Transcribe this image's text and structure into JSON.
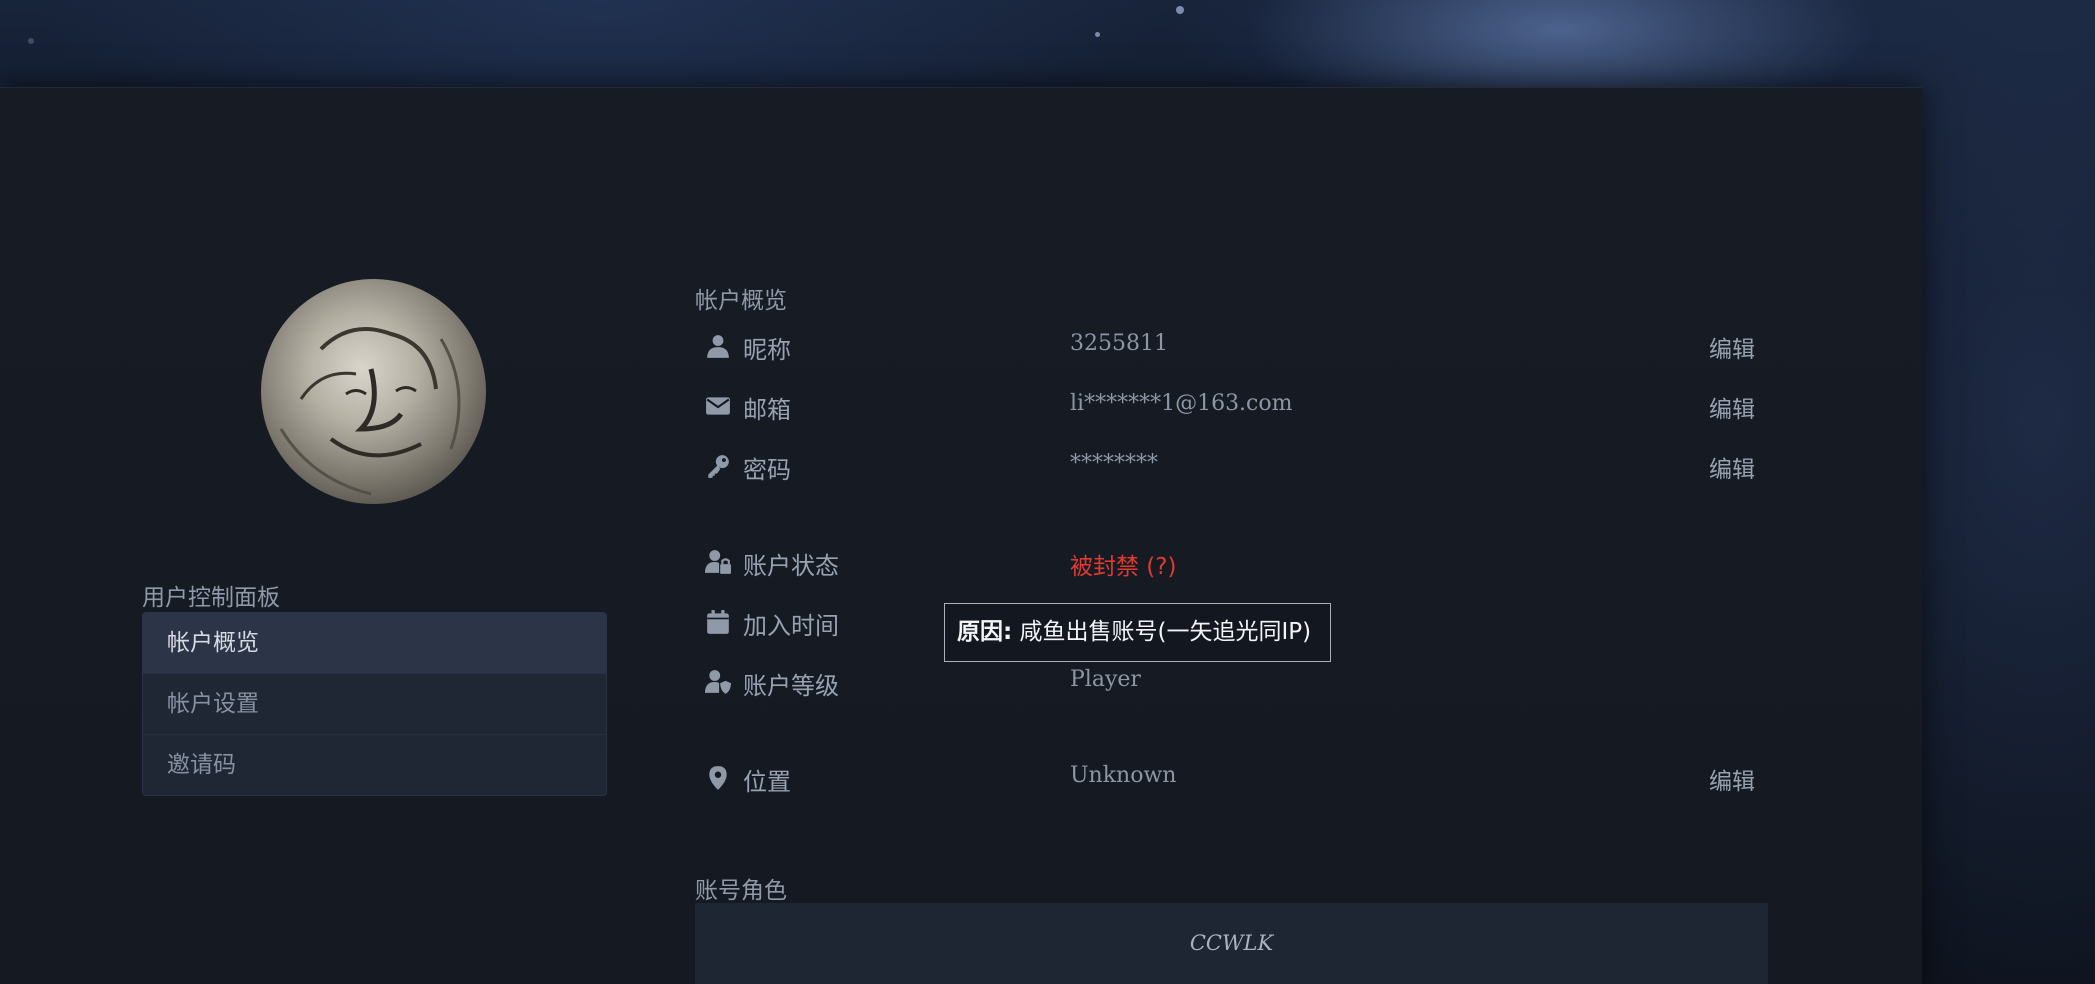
{
  "sidebar": {
    "title": "用户控制面板",
    "items": [
      {
        "label": "帐户概览",
        "active": true
      },
      {
        "label": "帐户设置",
        "active": false
      },
      {
        "label": "邀请码",
        "active": false
      }
    ]
  },
  "overview": {
    "title": "帐户概览",
    "rows": {
      "nickname": {
        "icon": "user-icon",
        "label": "昵称",
        "value": "3255811",
        "edit": "编辑"
      },
      "email": {
        "icon": "envelope-icon",
        "label": "邮箱",
        "value": "li*******1@163.com",
        "edit": "编辑"
      },
      "password": {
        "icon": "key-icon",
        "label": "密码",
        "value": "********",
        "edit": "编辑"
      },
      "status": {
        "icon": "user-lock-icon",
        "label": "账户状态",
        "value": "被封禁 (?)",
        "color": "#e0392f"
      },
      "joined": {
        "icon": "calendar-icon",
        "label": "加入时间"
      },
      "level": {
        "icon": "user-shield-icon",
        "label": "账户等级",
        "value": "Player"
      },
      "location": {
        "icon": "map-pin-icon",
        "label": "位置",
        "value": "Unknown",
        "edit": "编辑"
      }
    }
  },
  "tooltip": {
    "bold": "原因:",
    "text": " 咸鱼出售账号(一矢追光同IP)"
  },
  "characters": {
    "title": "账号角色",
    "items": [
      "CCWLK"
    ]
  }
}
